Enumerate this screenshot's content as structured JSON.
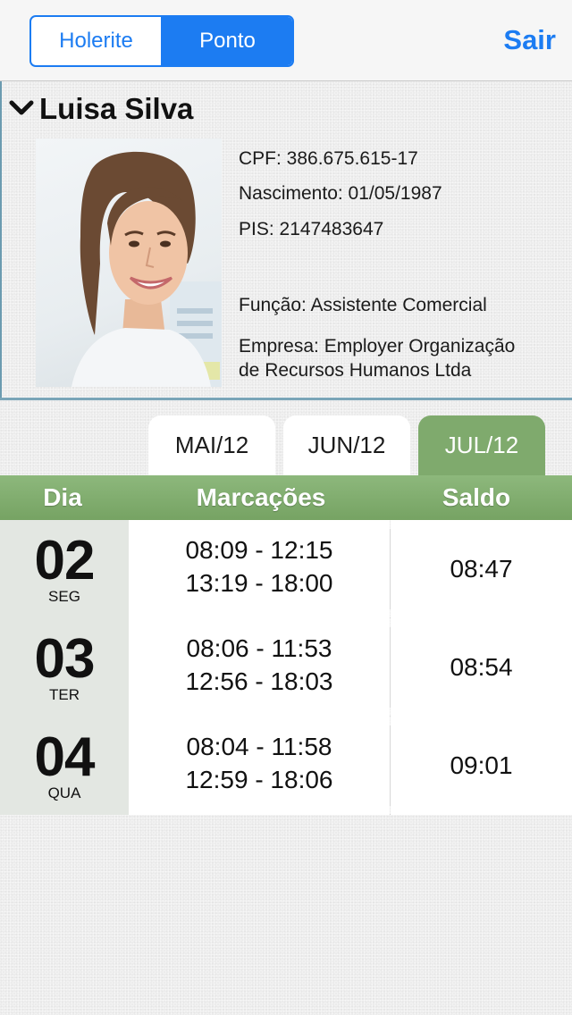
{
  "nav": {
    "segments": [
      "Holerite",
      "Ponto"
    ],
    "active_segment": "Ponto",
    "logout_label": "Sair",
    "accent_color": "#1c7cf2"
  },
  "employee": {
    "name": "Luisa Silva",
    "cpf": "CPF: 386.675.615-17",
    "birth": "Nascimento: 01/05/1987",
    "pis": "PIS: 2147483647",
    "role": "Função: Assistente Comercial",
    "company_line1": "Empresa: Employer Organização",
    "company_line2": "de Recursos Humanos Ltda"
  },
  "months": {
    "tabs": [
      "MAI/12",
      "JUN/12",
      "JUL/12"
    ],
    "active": "JUL/12",
    "active_color": "#7faa6d"
  },
  "table": {
    "headers": {
      "day": "Dia",
      "marks": "Marcações",
      "balance": "Saldo"
    },
    "rows": [
      {
        "day": "02",
        "weekday": "SEG",
        "marks": [
          "08:09 - 12:15",
          "13:19 - 18:00"
        ],
        "balance": "08:47"
      },
      {
        "day": "03",
        "weekday": "TER",
        "marks": [
          "08:06 - 11:53",
          "12:56 - 18:03"
        ],
        "balance": "08:54"
      },
      {
        "day": "04",
        "weekday": "QUA",
        "marks": [
          "08:04 - 11:58",
          "12:59 - 18:06"
        ],
        "balance": "09:01"
      }
    ]
  }
}
